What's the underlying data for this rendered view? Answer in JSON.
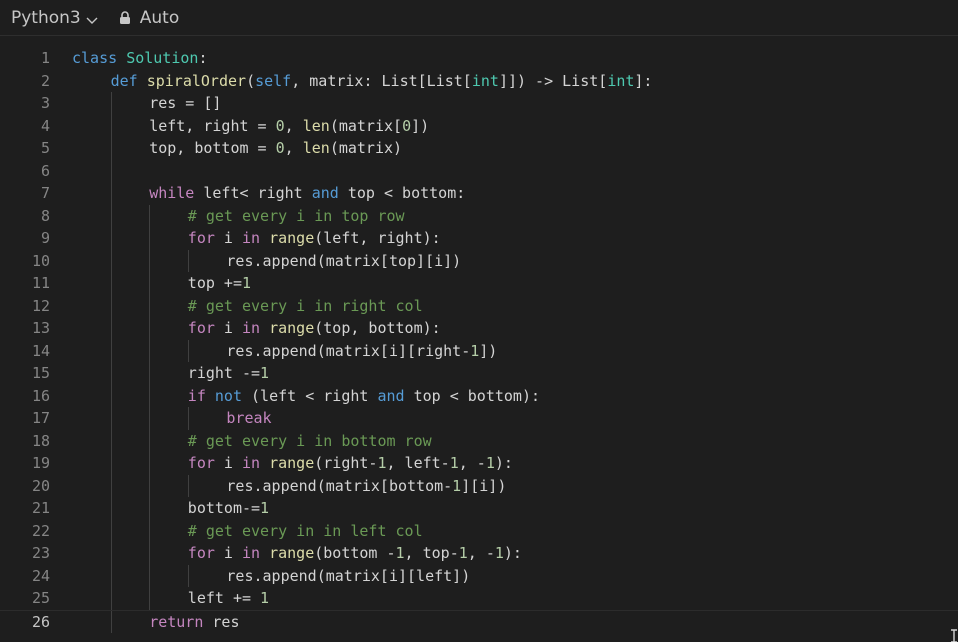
{
  "toolbar": {
    "language": "Python3",
    "mode": "Auto"
  },
  "icons": {
    "chevron": "chevron-down-icon",
    "lock": "lock-icon"
  },
  "editor": {
    "current_line": 26,
    "lines": [
      {
        "n": "1",
        "indent": 0,
        "tokens": [
          [
            "kw",
            "class"
          ],
          [
            "t",
            " "
          ],
          [
            "cls",
            "Solution"
          ],
          [
            "t",
            ":"
          ]
        ]
      },
      {
        "n": "2",
        "indent": 1,
        "tokens": [
          [
            "kw",
            "def"
          ],
          [
            "t",
            " "
          ],
          [
            "fn",
            "spiralOrder"
          ],
          [
            "t",
            "("
          ],
          [
            "kw",
            "self"
          ],
          [
            "t",
            ", matrix: List[List["
          ],
          [
            "ty",
            "int"
          ],
          [
            "t",
            "]]) -> List["
          ],
          [
            "ty",
            "int"
          ],
          [
            "t",
            "]:"
          ]
        ]
      },
      {
        "n": "3",
        "indent": 2,
        "tokens": [
          [
            "t",
            "res = []"
          ]
        ]
      },
      {
        "n": "4",
        "indent": 2,
        "tokens": [
          [
            "t",
            "left, right = "
          ],
          [
            "num",
            "0"
          ],
          [
            "t",
            ", "
          ],
          [
            "fn",
            "len"
          ],
          [
            "t",
            "(matrix["
          ],
          [
            "num",
            "0"
          ],
          [
            "t",
            "])"
          ]
        ]
      },
      {
        "n": "5",
        "indent": 2,
        "tokens": [
          [
            "t",
            "top, bottom = "
          ],
          [
            "num",
            "0"
          ],
          [
            "t",
            ", "
          ],
          [
            "fn",
            "len"
          ],
          [
            "t",
            "(matrix)"
          ]
        ]
      },
      {
        "n": "6",
        "indent": 2,
        "tokens": []
      },
      {
        "n": "7",
        "indent": 2,
        "tokens": [
          [
            "ctl",
            "while"
          ],
          [
            "t",
            " left< right "
          ],
          [
            "kw",
            "and"
          ],
          [
            "t",
            " top < bottom:"
          ]
        ]
      },
      {
        "n": "8",
        "indent": 3,
        "tokens": [
          [
            "cm",
            "# get every i in top row"
          ]
        ]
      },
      {
        "n": "9",
        "indent": 3,
        "tokens": [
          [
            "ctl",
            "for"
          ],
          [
            "t",
            " i "
          ],
          [
            "ctl",
            "in"
          ],
          [
            "t",
            " "
          ],
          [
            "fn",
            "range"
          ],
          [
            "t",
            "(left, right):"
          ]
        ]
      },
      {
        "n": "10",
        "indent": 4,
        "tokens": [
          [
            "t",
            "res.append(matrix[top][i])"
          ]
        ]
      },
      {
        "n": "11",
        "indent": 3,
        "tokens": [
          [
            "t",
            "top +="
          ],
          [
            "num",
            "1"
          ]
        ]
      },
      {
        "n": "12",
        "indent": 3,
        "tokens": [
          [
            "cm",
            "# get every i in right col"
          ]
        ]
      },
      {
        "n": "13",
        "indent": 3,
        "tokens": [
          [
            "ctl",
            "for"
          ],
          [
            "t",
            " i "
          ],
          [
            "ctl",
            "in"
          ],
          [
            "t",
            " "
          ],
          [
            "fn",
            "range"
          ],
          [
            "t",
            "(top, bottom):"
          ]
        ]
      },
      {
        "n": "14",
        "indent": 4,
        "tokens": [
          [
            "t",
            "res.append(matrix[i][right-"
          ],
          [
            "num",
            "1"
          ],
          [
            "t",
            "])"
          ]
        ]
      },
      {
        "n": "15",
        "indent": 3,
        "tokens": [
          [
            "t",
            "right -="
          ],
          [
            "num",
            "1"
          ]
        ]
      },
      {
        "n": "16",
        "indent": 3,
        "tokens": [
          [
            "ctl",
            "if"
          ],
          [
            "t",
            " "
          ],
          [
            "kw",
            "not"
          ],
          [
            "t",
            " (left < right "
          ],
          [
            "kw",
            "and"
          ],
          [
            "t",
            " top < bottom):"
          ]
        ]
      },
      {
        "n": "17",
        "indent": 4,
        "tokens": [
          [
            "ctl",
            "break"
          ]
        ]
      },
      {
        "n": "18",
        "indent": 3,
        "tokens": [
          [
            "cm",
            "# get every i in bottom row"
          ]
        ]
      },
      {
        "n": "19",
        "indent": 3,
        "tokens": [
          [
            "ctl",
            "for"
          ],
          [
            "t",
            " i "
          ],
          [
            "ctl",
            "in"
          ],
          [
            "t",
            " "
          ],
          [
            "fn",
            "range"
          ],
          [
            "t",
            "(right-"
          ],
          [
            "num",
            "1"
          ],
          [
            "t",
            ", left-"
          ],
          [
            "num",
            "1"
          ],
          [
            "t",
            ", -"
          ],
          [
            "num",
            "1"
          ],
          [
            "t",
            "):"
          ]
        ]
      },
      {
        "n": "20",
        "indent": 4,
        "tokens": [
          [
            "t",
            "res.append(matrix[bottom-"
          ],
          [
            "num",
            "1"
          ],
          [
            "t",
            "][i])"
          ]
        ]
      },
      {
        "n": "21",
        "indent": 3,
        "tokens": [
          [
            "t",
            "bottom-="
          ],
          [
            "num",
            "1"
          ]
        ]
      },
      {
        "n": "22",
        "indent": 3,
        "tokens": [
          [
            "cm",
            "# get every in in left col"
          ]
        ]
      },
      {
        "n": "23",
        "indent": 3,
        "tokens": [
          [
            "ctl",
            "for"
          ],
          [
            "t",
            " i "
          ],
          [
            "ctl",
            "in"
          ],
          [
            "t",
            " "
          ],
          [
            "fn",
            "range"
          ],
          [
            "t",
            "(bottom -"
          ],
          [
            "num",
            "1"
          ],
          [
            "t",
            ", top-"
          ],
          [
            "num",
            "1"
          ],
          [
            "t",
            ", -"
          ],
          [
            "num",
            "1"
          ],
          [
            "t",
            "):"
          ]
        ]
      },
      {
        "n": "24",
        "indent": 4,
        "tokens": [
          [
            "t",
            "res.append(matrix[i][left])"
          ]
        ]
      },
      {
        "n": "25",
        "indent": 3,
        "tokens": [
          [
            "t",
            "left += "
          ],
          [
            "num",
            "1"
          ]
        ]
      },
      {
        "n": "26",
        "indent": 2,
        "tokens": [
          [
            "ctl",
            "return"
          ],
          [
            "t",
            " res"
          ]
        ]
      }
    ]
  },
  "colors": {
    "background": "#1e1e1e",
    "keyword": "#569cd6",
    "control": "#c586c0",
    "function": "#dcdcaa",
    "class": "#4ec9b0",
    "number": "#b5cea8",
    "comment": "#6a9955",
    "text": "#d4d4d4",
    "line_number": "#858585"
  }
}
